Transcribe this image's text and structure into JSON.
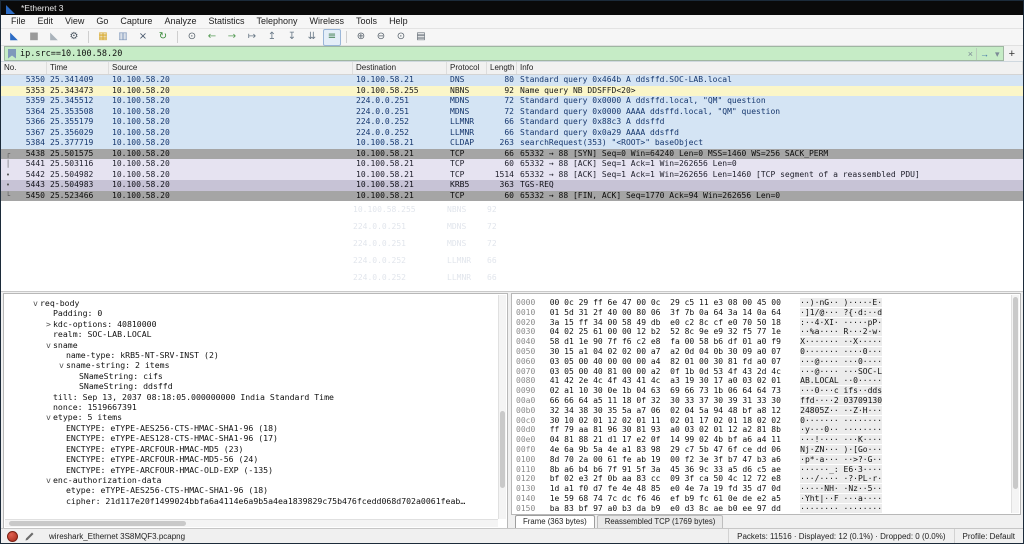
{
  "colors": {
    "filter_bg": "#c6ecc6",
    "udp_bg": "#d4e4f4",
    "udp_fg": "#16376e",
    "nbns_bg": "#fbf6c8",
    "tcp_bg": "#e6e3f1",
    "synfin_bg": "#a5a5a5",
    "sel_bg": "#c7c3d6",
    "accent": "#2b6bc4"
  },
  "window": {
    "title": "*Ethernet 3"
  },
  "menu": [
    "File",
    "Edit",
    "View",
    "Go",
    "Capture",
    "Analyze",
    "Statistics",
    "Telephony",
    "Wireless",
    "Tools",
    "Help"
  ],
  "toolbar": [
    {
      "name": "start-capture-button",
      "icon": "shark-fin-icon",
      "glyph": "◣",
      "color": "#2b6bc4"
    },
    {
      "name": "stop-capture-button",
      "icon": "stop-square-icon",
      "glyph": "■",
      "color": "#9a9a9a"
    },
    {
      "name": "restart-capture-button",
      "icon": "restart-fin-icon",
      "glyph": "◣",
      "color": "#a9b2ba"
    },
    {
      "name": "capture-options-button",
      "icon": "gear-icon",
      "glyph": "⚙",
      "color": "#4a5560"
    },
    {
      "sep": true
    },
    {
      "name": "open-file-button",
      "icon": "folder-icon",
      "glyph": "▦",
      "color": "#d8a829"
    },
    {
      "name": "save-file-button",
      "icon": "save-icon",
      "glyph": "▥",
      "color": "#7a93b8"
    },
    {
      "name": "close-file-button",
      "icon": "close-icon",
      "glyph": "×",
      "color": "#47566b"
    },
    {
      "name": "reload-button",
      "icon": "reload-icon",
      "glyph": "↻",
      "color": "#3c8c3c"
    },
    {
      "sep": true
    },
    {
      "name": "find-packet-button",
      "icon": "magnifier-icon",
      "glyph": "⊙",
      "color": "#55606a"
    },
    {
      "name": "go-back-button",
      "icon": "arrow-left-icon",
      "glyph": "←",
      "color": "#5a9e5a"
    },
    {
      "name": "go-forward-button",
      "icon": "arrow-right-icon",
      "glyph": "→",
      "color": "#5a9e5a"
    },
    {
      "name": "go-to-packet-button",
      "icon": "go-to-packet-icon",
      "glyph": "↦",
      "color": "#6b7a88"
    },
    {
      "name": "go-to-first-button",
      "icon": "arrow-up-bar-icon",
      "glyph": "↥",
      "color": "#6b7a88"
    },
    {
      "name": "go-to-last-button",
      "icon": "arrow-down-bar-icon",
      "glyph": "↧",
      "color": "#6b7a88"
    },
    {
      "name": "auto-scroll-button",
      "icon": "auto-scroll-icon",
      "glyph": "⇊",
      "color": "#6b7a88"
    },
    {
      "name": "colorize-button",
      "icon": "colorize-list-icon",
      "glyph": "≡",
      "color": "#3a7a4a",
      "pressed": true
    },
    {
      "sep": true
    },
    {
      "name": "zoom-in-button",
      "icon": "zoom-in-icon",
      "glyph": "⊕",
      "color": "#55606a"
    },
    {
      "name": "zoom-out-button",
      "icon": "zoom-out-icon",
      "glyph": "⊖",
      "color": "#55606a"
    },
    {
      "name": "zoom-reset-button",
      "icon": "zoom-reset-icon",
      "glyph": "⊙",
      "color": "#55606a"
    },
    {
      "name": "resize-columns-button",
      "icon": "resize-columns-icon",
      "glyph": "▤",
      "color": "#55606a"
    }
  ],
  "filter": {
    "value": "ip.src==10.100.58.20",
    "clear_label": "×",
    "apply_label": "→",
    "dropdown_label": "▾",
    "add_label": "+"
  },
  "packet_list": {
    "columns": [
      "No.",
      "Time",
      "Source",
      "Destination",
      "Protocol",
      "Length",
      "Info"
    ],
    "rows": [
      {
        "no": "5350",
        "time": "25.341409",
        "src": "10.100.58.20",
        "dst": "10.100.58.21",
        "proto": "DNS",
        "len": "80",
        "info": "Standard query 0x464b A ddsffd.SOC-LAB.local",
        "style": "udp",
        "mk": ""
      },
      {
        "no": "5353",
        "time": "25.343473",
        "src": "10.100.58.20",
        "dst": "10.100.58.255",
        "proto": "NBNS",
        "len": "92",
        "info": "Name query NB DDSFFD<20>",
        "style": "nbns",
        "mk": ""
      },
      {
        "no": "5359",
        "time": "25.345512",
        "src": "10.100.58.20",
        "dst": "224.0.0.251",
        "proto": "MDNS",
        "len": "72",
        "info": "Standard query 0x0000 A ddsffd.local, \"QM\" question",
        "style": "udp",
        "mk": ""
      },
      {
        "no": "5364",
        "time": "25.353508",
        "src": "10.100.58.20",
        "dst": "224.0.0.251",
        "proto": "MDNS",
        "len": "72",
        "info": "Standard query 0x0000 AAAA ddsffd.local, \"QM\" question",
        "style": "udp",
        "mk": ""
      },
      {
        "no": "5366",
        "time": "25.355179",
        "src": "10.100.58.20",
        "dst": "224.0.0.252",
        "proto": "LLMNR",
        "len": "66",
        "info": "Standard query 0x88c3 A ddsffd",
        "style": "udp",
        "mk": ""
      },
      {
        "no": "5367",
        "time": "25.356029",
        "src": "10.100.58.20",
        "dst": "224.0.0.252",
        "proto": "LLMNR",
        "len": "66",
        "info": "Standard query 0x0a29 AAAA ddsffd",
        "style": "udp",
        "mk": ""
      },
      {
        "no": "5384",
        "time": "25.377719",
        "src": "10.100.58.20",
        "dst": "10.100.58.21",
        "proto": "CLDAP",
        "len": "263",
        "info": "searchRequest(353) \"<ROOT>\" baseObject",
        "style": "udp",
        "mk": ""
      },
      {
        "no": "5438",
        "time": "25.501575",
        "src": "10.100.58.20",
        "dst": "10.100.58.21",
        "proto": "TCP",
        "len": "66",
        "info": "65332 → 88 [SYN] Seq=0 Win=64240 Len=0 MSS=1460 WS=256 SACK_PERM",
        "style": "synfin",
        "mk": "┌"
      },
      {
        "no": "5441",
        "time": "25.503116",
        "src": "10.100.58.20",
        "dst": "10.100.58.21",
        "proto": "TCP",
        "len": "60",
        "info": "65332 → 88 [ACK] Seq=1 Ack=1 Win=262656 Len=0",
        "style": "tcp",
        "mk": "│"
      },
      {
        "no": "5442",
        "time": "25.504982",
        "src": "10.100.58.20",
        "dst": "10.100.58.21",
        "proto": "TCP",
        "len": "1514",
        "info": "65332 → 88 [ACK] Seq=1 Ack=1 Win=262656 Len=1460 [TCP segment of a reassembled PDU]",
        "style": "tcp",
        "mk": "•"
      },
      {
        "no": "5443",
        "time": "25.504983",
        "src": "10.100.58.20",
        "dst": "10.100.58.21",
        "proto": "KRB5",
        "len": "363",
        "info": "TGS-REQ",
        "style": "selected",
        "mk": "•"
      },
      {
        "no": "5450",
        "time": "25.523466",
        "src": "10.100.58.20",
        "dst": "10.100.58.21",
        "proto": "TCP",
        "len": "60",
        "info": "65332 → 88 [FIN, ACK] Seq=1770 Ack=94 Win=262656 Len=0",
        "style": "synfin",
        "mk": "└"
      }
    ],
    "ghost_rows": [
      {
        "dst": "10.100.58.255",
        "proto": "NBNS",
        "len": "92"
      },
      {
        "dst": "224.0.0.251",
        "proto": "MDNS",
        "len": "72"
      },
      {
        "dst": "224.0.0.251",
        "proto": "MDNS",
        "len": "72"
      },
      {
        "dst": "224.0.0.252",
        "proto": "LLMNR",
        "len": "66"
      },
      {
        "dst": "224.0.0.252",
        "proto": "LLMNR",
        "len": "66"
      }
    ]
  },
  "details": {
    "lines": [
      {
        "indent": 1,
        "arrow": "v",
        "text": "req-body"
      },
      {
        "indent": 2,
        "arrow": "",
        "text": "Padding: 0"
      },
      {
        "indent": 2,
        "arrow": ">",
        "text": "kdc-options: 40810000"
      },
      {
        "indent": 2,
        "arrow": "",
        "text": "realm: SOC-LAB.LOCAL"
      },
      {
        "indent": 2,
        "arrow": "v",
        "text": "sname"
      },
      {
        "indent": 3,
        "arrow": "",
        "text": "name-type: kRB5-NT-SRV-INST (2)"
      },
      {
        "indent": 3,
        "arrow": "v",
        "text": "sname-string: 2 items"
      },
      {
        "indent": 4,
        "arrow": "",
        "text": "SNameString: cifs"
      },
      {
        "indent": 4,
        "arrow": "",
        "text": "SNameString: ddsffd"
      },
      {
        "indent": 2,
        "arrow": "",
        "text": "till: Sep 13, 2037 08:18:05.000000000 India Standard Time"
      },
      {
        "indent": 2,
        "arrow": "",
        "text": "nonce: 1519667391"
      },
      {
        "indent": 2,
        "arrow": "v",
        "text": "etype: 5 items"
      },
      {
        "indent": 3,
        "arrow": "",
        "text": "ENCTYPE: eTYPE-AES256-CTS-HMAC-SHA1-96 (18)"
      },
      {
        "indent": 3,
        "arrow": "",
        "text": "ENCTYPE: eTYPE-AES128-CTS-HMAC-SHA1-96 (17)"
      },
      {
        "indent": 3,
        "arrow": "",
        "text": "ENCTYPE: eTYPE-ARCFOUR-HMAC-MD5 (23)"
      },
      {
        "indent": 3,
        "arrow": "",
        "text": "ENCTYPE: eTYPE-ARCFOUR-HMAC-MD5-56 (24)"
      },
      {
        "indent": 3,
        "arrow": "",
        "text": "ENCTYPE: eTYPE-ARCFOUR-HMAC-OLD-EXP (-135)"
      },
      {
        "indent": 2,
        "arrow": "v",
        "text": "enc-authorization-data"
      },
      {
        "indent": 3,
        "arrow": "",
        "text": "etype: eTYPE-AES256-CTS-HMAC-SHA1-96 (18)"
      },
      {
        "indent": 3,
        "arrow": "",
        "text": "cipher: 21d117e20f1499024bbfa6a4114e6a9b5a4ea1839829c75b476fcedd068d702a0061feab…"
      }
    ]
  },
  "hex": {
    "rows": [
      {
        "off": "0000",
        "hx": "00 0c 29 ff 6e 47 00 0c  29 c5 11 e3 08 00 45 00",
        "asc": "··)·nG·· )·····E·"
      },
      {
        "off": "0010",
        "hx": "01 5d 31 2f 40 00 80 06  3f 7b 0a 64 3a 14 0a 64",
        "asc": "·]1/@··· ?{·d:··d"
      },
      {
        "off": "0020",
        "hx": "3a 15 ff 34 00 58 49 db  e0 c2 8c cf e0 70 50 18",
        "asc": ":··4·XI· ·····pP·"
      },
      {
        "off": "0030",
        "hx": "04 02 25 61 00 00 12 b2  52 8c 9e e9 32 f5 77 1e",
        "asc": "··%a···· R···2·w·"
      },
      {
        "off": "0040",
        "hx": "58 d1 1e 90 7f f6 c2 e8  fa 00 58 b6 df 01 a0 f9",
        "asc": "X······· ··X·····"
      },
      {
        "off": "0050",
        "hx": "30 15 a1 04 02 02 00 a7  a2 0d 04 0b 30 09 a0 07",
        "asc": "0······· ····0···"
      },
      {
        "off": "0060",
        "hx": "03 05 00 40 00 00 00 a4  82 01 00 30 81 fd a0 07",
        "asc": "···@···· ···0····"
      },
      {
        "off": "0070",
        "hx": "03 05 00 40 81 00 00 a2  0f 1b 0d 53 4f 43 2d 4c",
        "asc": "···@···· ···SOC-L"
      },
      {
        "off": "0080",
        "hx": "41 42 2e 4c 4f 43 41 4c  a3 19 30 17 a0 03 02 01",
        "asc": "AB.LOCAL ··0·····"
      },
      {
        "off": "0090",
        "hx": "02 a1 10 30 0e 1b 04 63  69 66 73 1b 06 64 64 73",
        "asc": "···0···c ifs··dds"
      },
      {
        "off": "00a0",
        "hx": "66 66 64 a5 11 18 0f 32  30 33 37 30 39 31 33 30",
        "asc": "ffd····2 03709130"
      },
      {
        "off": "00b0",
        "hx": "32 34 38 30 35 5a a7 06  02 04 5a 94 48 bf a8 12",
        "asc": "24805Z·· ··Z·H···"
      },
      {
        "off": "00c0",
        "hx": "30 10 02 01 12 02 01 11  02 01 17 02 01 18 02 02",
        "asc": "0······· ········"
      },
      {
        "off": "00d0",
        "hx": "ff 79 aa 81 96 30 81 93  a0 03 02 01 12 a2 81 8b",
        "asc": "·y···0·· ········"
      },
      {
        "off": "00e0",
        "hx": "04 81 88 21 d1 17 e2 0f  14 99 02 4b bf a6 a4 11",
        "asc": "···!···· ···K····"
      },
      {
        "off": "00f0",
        "hx": "4e 6a 9b 5a 4e a1 83 98  29 c7 5b 47 6f ce dd 06",
        "asc": "Nj·ZN··· )·[Go···"
      },
      {
        "off": "0100",
        "hx": "8d 70 2a 00 61 fe ab 19  00 f2 3e 3f b7 47 b3 a6",
        "asc": "·p*·a··· ··>?·G··"
      },
      {
        "off": "0110",
        "hx": "8b a6 b4 b6 7f 91 5f 3a  45 36 9c 33 a5 d6 c5 ae",
        "asc": "······_: E6·3····"
      },
      {
        "off": "0120",
        "hx": "bf 02 e3 2f 0b aa 83 cc  09 3f ca 50 4c 12 72 e8",
        "asc": "···/···· ·?·PL·r·"
      },
      {
        "off": "0130",
        "hx": "1d a1 f0 d7 fe 4e 48 85  e0 4e 7a 19 fd 35 d7 0d",
        "asc": "·····NH· ·Nz··5··"
      },
      {
        "off": "0140",
        "hx": "1e 59 68 74 7c dc f6 46  ef b9 fc 61 0e de e2 a5",
        "asc": "·Yht|··F ···a····"
      },
      {
        "off": "0150",
        "hx": "ba 83 bf 97 a0 b3 da b9  e0 d3 8c ae b0 ee 97 dd",
        "asc": "········ ········"
      }
    ]
  },
  "hex_tabs": [
    {
      "label": "Frame (363 bytes)",
      "active": true
    },
    {
      "label": "Reassembled TCP (1769 bytes)",
      "active": false
    }
  ],
  "status": {
    "file": "wireshark_Ethernet 3S8MQF3.pcapng",
    "counts": "Packets: 11516 · Displayed: 12 (0.1%) · Dropped: 0 (0.0%)",
    "profile": "Profile: Default"
  }
}
